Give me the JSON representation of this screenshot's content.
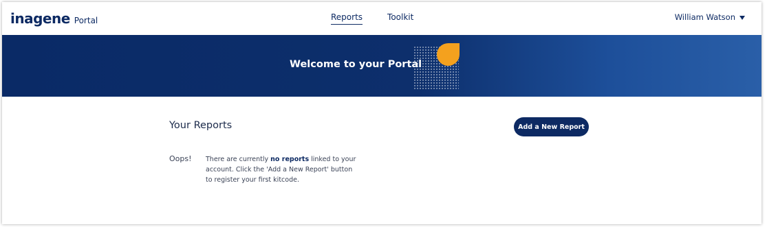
{
  "header": {
    "logo": "inagene",
    "logo_sub": "Portal",
    "nav": [
      {
        "label": "Reports",
        "active": true
      },
      {
        "label": "Toolkit",
        "active": false
      }
    ],
    "user_name": "William Watson"
  },
  "banner": {
    "title": "Welcome to your Portal"
  },
  "reports": {
    "title": "Your Reports",
    "add_button": "Add a New Report",
    "empty_label": "Oops!",
    "empty_message_pre": "There are currently ",
    "empty_message_bold": "no reports",
    "empty_message_post": " linked to your account. Click the 'Add a New Report' button to register your first kitcode."
  },
  "colors": {
    "brand_navy": "#0d2a63",
    "accent_orange": "#f4a11e"
  }
}
